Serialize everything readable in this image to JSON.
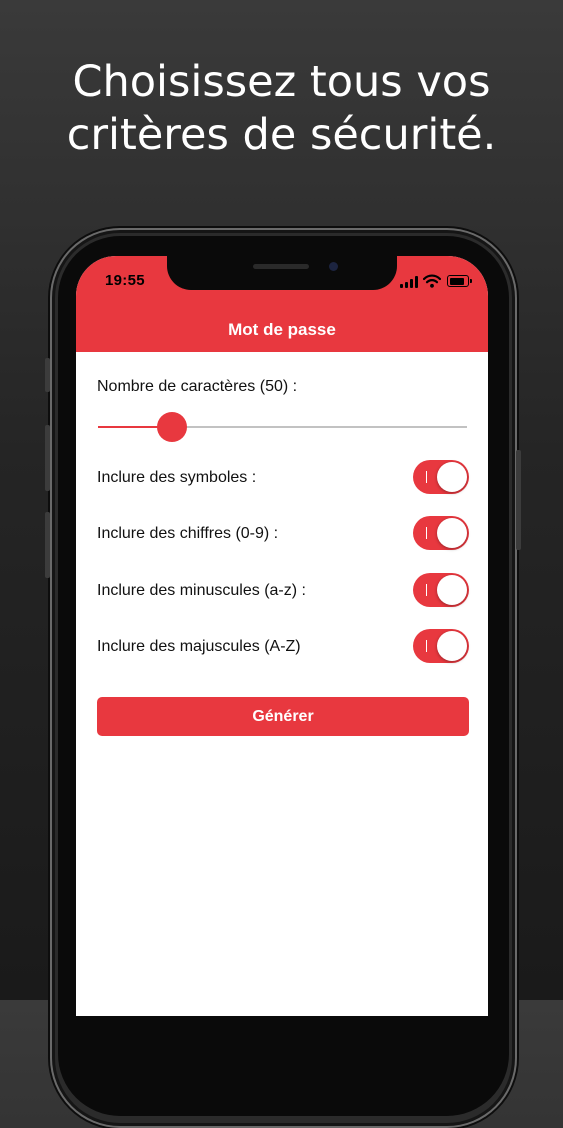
{
  "promo": {
    "headline_line1": "Choisissez tous vos",
    "headline_line2": "critères de sécurité."
  },
  "status_bar": {
    "time": "19:55",
    "icons": [
      "signal-icon",
      "wifi-icon",
      "battery-icon"
    ]
  },
  "app_bar": {
    "title": "Mot de passe"
  },
  "length": {
    "label": "Nombre de caractères (50) :",
    "slider_fraction": 0.2
  },
  "options": [
    {
      "label": "Inclure des symboles :",
      "enabled": true
    },
    {
      "label": "Inclure des chiffres (0-9) :",
      "enabled": true
    },
    {
      "label": "Inclure des minuscules (a-z) :",
      "enabled": true
    },
    {
      "label": "Inclure des majuscules (A-Z)",
      "enabled": true
    }
  ],
  "generate_button": {
    "label": "Générer"
  },
  "colors": {
    "accent": "#e8383f",
    "background_top": "#3a3a3a",
    "background_bottom": "#1a1a1a",
    "text": "#111111"
  }
}
